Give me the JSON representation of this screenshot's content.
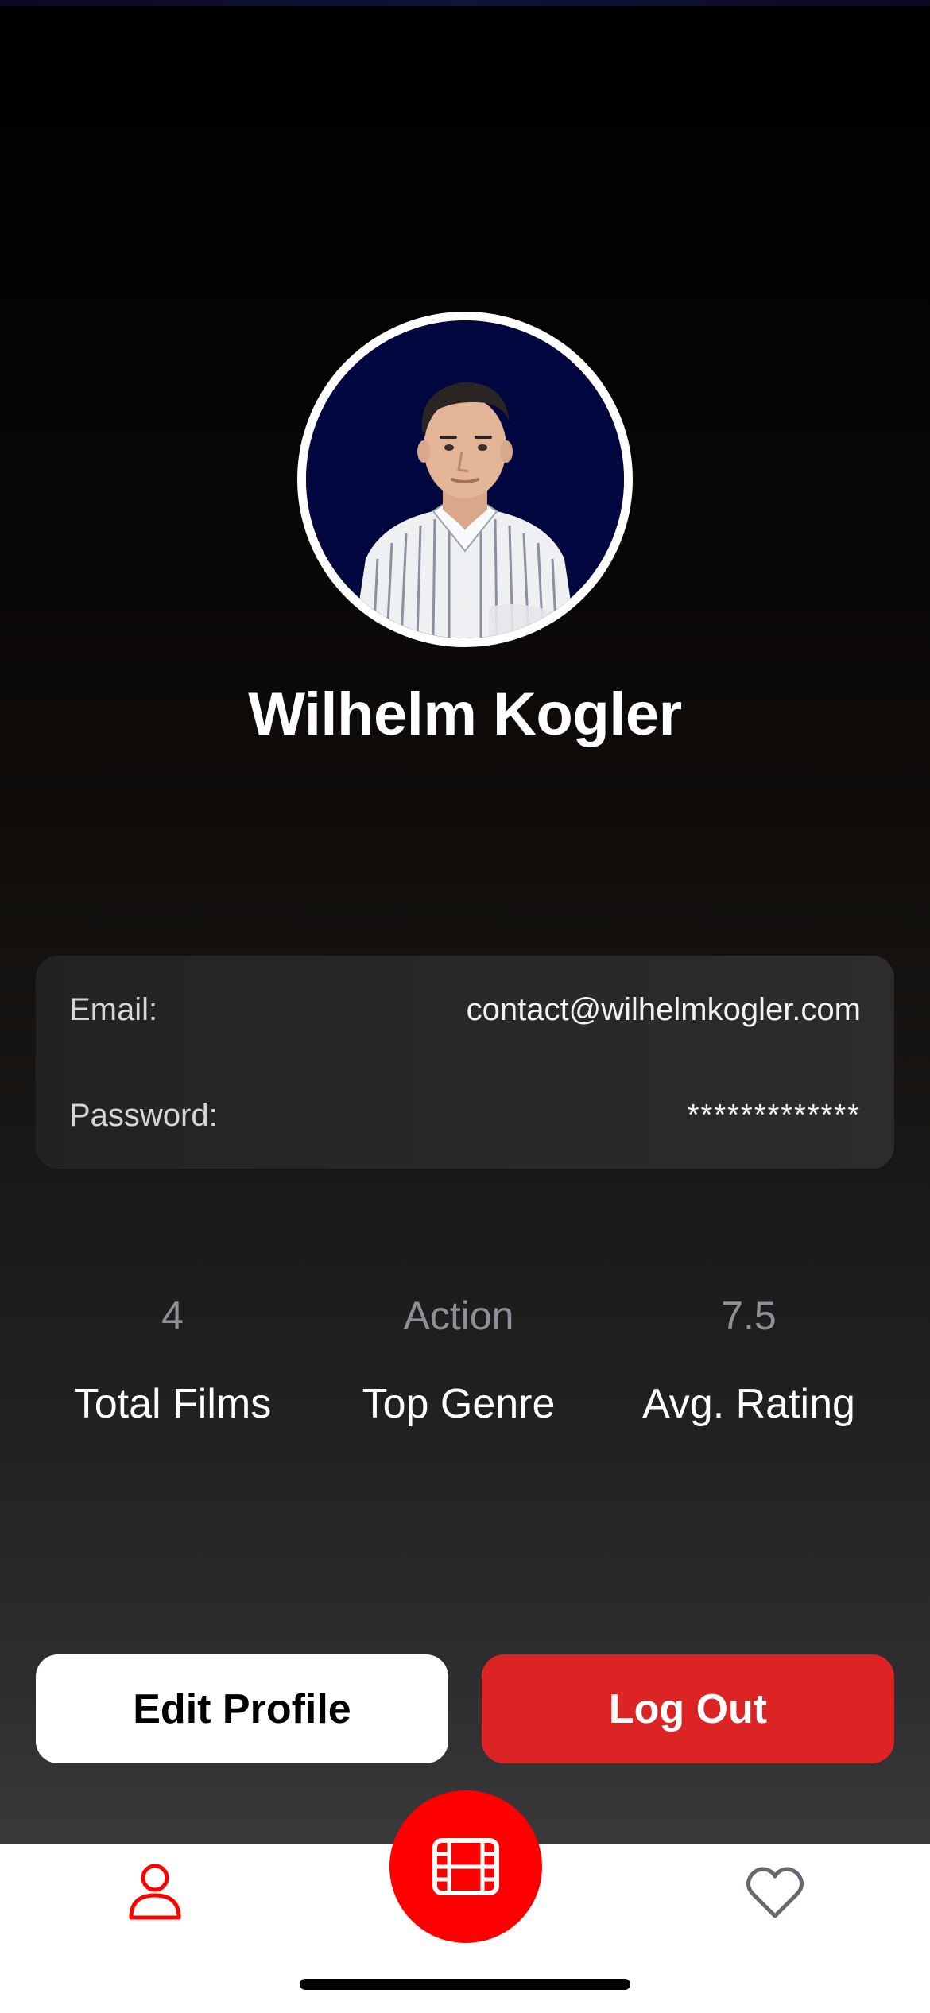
{
  "profile": {
    "name": "Wilhelm Kogler",
    "avatar_alt": "profile-photo"
  },
  "credentials": {
    "email_label": "Email:",
    "email_value": "contact@wilhelmkogler.com",
    "password_label": "Password:",
    "password_value": "*************"
  },
  "stats": [
    {
      "value": "4",
      "label": "Total Films"
    },
    {
      "value": "Action",
      "label": "Top Genre"
    },
    {
      "value": "7.5",
      "label": "Avg. Rating"
    }
  ],
  "actions": {
    "edit_label": "Edit Profile",
    "logout_label": "Log Out"
  },
  "tabbar": {
    "left_icon": "user-icon",
    "center_icon": "film-icon",
    "right_icon": "heart-icon",
    "active_color": "#ff0000"
  },
  "colors": {
    "accent": "#dc2424",
    "fab": "#ff0000",
    "avatar_bg": "#03073f"
  }
}
